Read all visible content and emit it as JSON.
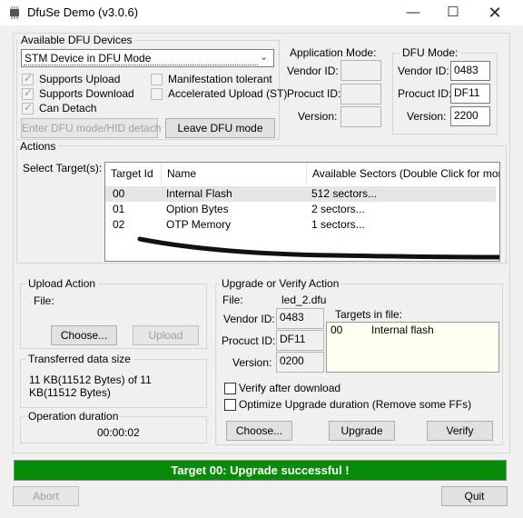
{
  "window": {
    "title": "DfuSe Demo (v3.0.6)",
    "minimize_icon": "minimize-icon",
    "maximize_icon": "maximize-icon",
    "close_icon": "close-icon"
  },
  "devices": {
    "group_label": "Available DFU Devices",
    "selected_device": "STM Device in DFU Mode",
    "checkboxes": [
      {
        "label": "Supports Upload",
        "checked": true
      },
      {
        "label": "Supports Download",
        "checked": true
      },
      {
        "label": "Can Detach",
        "checked": true
      },
      {
        "label": "Manifestation tolerant",
        "checked": false
      },
      {
        "label": "Accelerated Upload (ST)",
        "checked": false
      }
    ],
    "enter_dfu_label": "Enter DFU mode/HID detach",
    "leave_dfu_label": "Leave DFU mode"
  },
  "app_mode": {
    "label": "Application Mode:",
    "vendor_label": "Vendor ID:",
    "product_label": "Procuct ID:",
    "version_label": "Version:",
    "vendor": "",
    "product": "",
    "version": ""
  },
  "dfu_mode": {
    "label": "DFU Mode:",
    "vendor_label": "Vendor ID:",
    "product_label": "Procuct ID:",
    "version_label": "Version:",
    "vendor": "0483",
    "product": "DF11",
    "version": "2200"
  },
  "actions": {
    "group_label": "Actions",
    "select_target_label": "Select Target(s):",
    "columns": [
      "Target Id",
      "Name",
      "Available Sectors (Double Click for more)"
    ],
    "rows": [
      {
        "id": "00",
        "name": "Internal Flash",
        "sectors": "512 sectors..."
      },
      {
        "id": "01",
        "name": "Option Bytes",
        "sectors": "2 sectors..."
      },
      {
        "id": "02",
        "name": "OTP Memory",
        "sectors": "1 sectors..."
      }
    ]
  },
  "upload": {
    "group_label": "Upload Action",
    "file_label": "File:",
    "choose_label": "Choose...",
    "upload_label": "Upload"
  },
  "transferred": {
    "group_label": "Transferred data size",
    "text": "11 KB(11512 Bytes) of 11 KB(11512 Bytes)"
  },
  "duration": {
    "group_label": "Operation duration",
    "value": "00:00:02"
  },
  "upgrade": {
    "group_label": "Upgrade or Verify Action",
    "file_label": "File:",
    "file_name": "led_2.dfu",
    "vendor_label": "Vendor ID:",
    "vendor": "0483",
    "product_label": "Procuct ID:",
    "product": "DF11",
    "version_label": "Version:",
    "version": "0200",
    "targets_label": "Targets in file:",
    "target_id": "00",
    "target_name": "Internal flash",
    "verify_label": "Verify after download",
    "optimize_label": "Optimize Upgrade duration (Remove some FFs)",
    "choose_label": "Choose...",
    "upgrade_label": "Upgrade",
    "verify_button_label": "Verify"
  },
  "status": "Target 00: Upgrade successful !",
  "footer": {
    "abort_label": "Abort",
    "quit_label": "Quit"
  },
  "colors": {
    "status_bg": "#068c06",
    "window_bg": "#f0f0f0"
  }
}
